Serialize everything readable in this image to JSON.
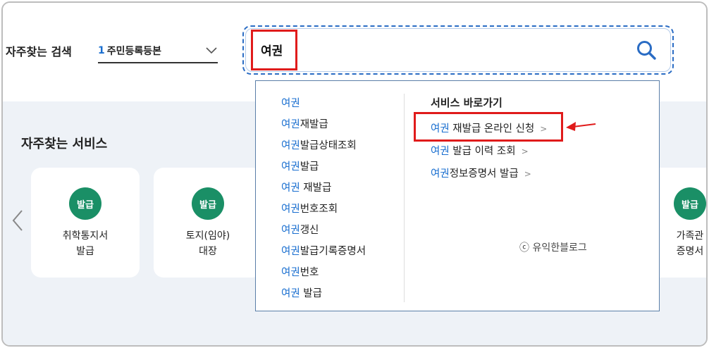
{
  "favorite_search": {
    "label": "자주찾는 검색",
    "selected_number": "1",
    "selected_text": "주민등록등본"
  },
  "search": {
    "value": "여권"
  },
  "services": {
    "title": "자주찾는 서비스",
    "cards": [
      {
        "badge": "발급",
        "label": "취학통지서\n발급"
      },
      {
        "badge": "발급",
        "label": "토지(임야)\n대장"
      },
      {
        "badge": "발급",
        "label": "가족관\n증명서"
      }
    ]
  },
  "suggestions": [
    {
      "hl": "여권",
      "rest": ""
    },
    {
      "hl": "여권",
      "rest": "재발급"
    },
    {
      "hl": "여권",
      "rest": "발급상태조회"
    },
    {
      "hl": "여권",
      "rest": "발급"
    },
    {
      "hl": "여권",
      "rest": " 재발급"
    },
    {
      "hl": "여권",
      "rest": "번호조회"
    },
    {
      "hl": "여권",
      "rest": "갱신"
    },
    {
      "hl": "여권",
      "rest": "발급기록증명서"
    },
    {
      "hl": "여권",
      "rest": "번호"
    },
    {
      "hl": "여권",
      "rest": " 발급"
    }
  ],
  "shortcuts": {
    "title": "서비스 바로가기",
    "links": [
      {
        "hl": "여권",
        "rest": " 재발급 온라인 신청",
        "arrow": ">"
      },
      {
        "hl": "여권",
        "rest": " 발급 이력 조회",
        "arrow": ">"
      },
      {
        "hl": "여권",
        "rest": "정보증명서 발급",
        "arrow": ">"
      }
    ]
  },
  "watermark": "ⓒ 유익한블로그",
  "colors": {
    "accent_blue": "#1a6fd0",
    "badge_green": "#1a8f66",
    "highlight_red": "#e01b1b"
  }
}
